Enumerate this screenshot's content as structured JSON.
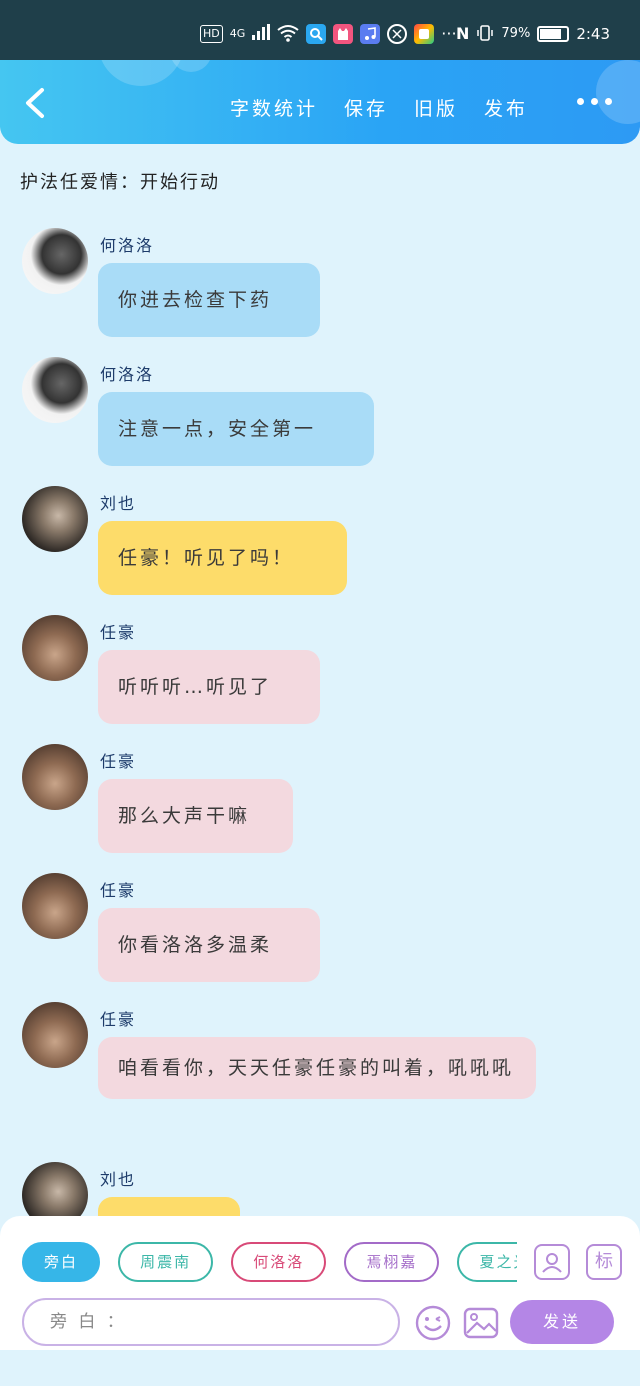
{
  "status_bar": {
    "left_icons": [
      "HD",
      "4G",
      "signal-icon",
      "wifi-icon",
      "app-icon",
      "app-icon",
      "app-icon",
      "app-icon",
      "app-icon",
      "···"
    ],
    "nfc": "N",
    "battery_percent": "79%",
    "battery_level": 0.79,
    "time": "2:43"
  },
  "header": {
    "actions": [
      "字数统计",
      "保存",
      "旧版",
      "发布"
    ]
  },
  "chat_title": "护法任爱情：开始行动",
  "messages": [
    {
      "name": "何洛洛",
      "text": "你进去检查下药",
      "bubble": "blue"
    },
    {
      "name": "何洛洛",
      "text": "注意一点，安全第一",
      "bubble": "blue"
    },
    {
      "name": "刘也",
      "text": "任豪！听见了吗！",
      "bubble": "yellow"
    },
    {
      "name": "任豪",
      "text": "听听听…听见了",
      "bubble": "pink"
    },
    {
      "name": "任豪",
      "text": "那么大声干嘛",
      "bubble": "pink"
    },
    {
      "name": "任豪",
      "text": "你看洛洛多温柔",
      "bubble": "pink"
    },
    {
      "name": "任豪",
      "text": "咱看看你，天天任豪任豪的叫着，吼吼吼",
      "bubble": "pink"
    },
    {
      "name": "刘也",
      "text": "",
      "bubble": "yellow"
    }
  ],
  "roles": [
    {
      "label": "旁白",
      "color": "#36b6e8",
      "filled": true
    },
    {
      "label": "周震南",
      "color": "#3cb7a8",
      "filled": false
    },
    {
      "label": "何洛洛",
      "color": "#d84a78",
      "filled": false
    },
    {
      "label": "焉栩嘉",
      "color": "#a36bc8",
      "filled": false
    },
    {
      "label": "夏之光",
      "color": "#3cb7a8",
      "filled": false
    }
  ],
  "tool_buttons": {
    "label_tag": "标"
  },
  "input": {
    "placeholder": "旁 白 ："
  },
  "send_label": "发送"
}
